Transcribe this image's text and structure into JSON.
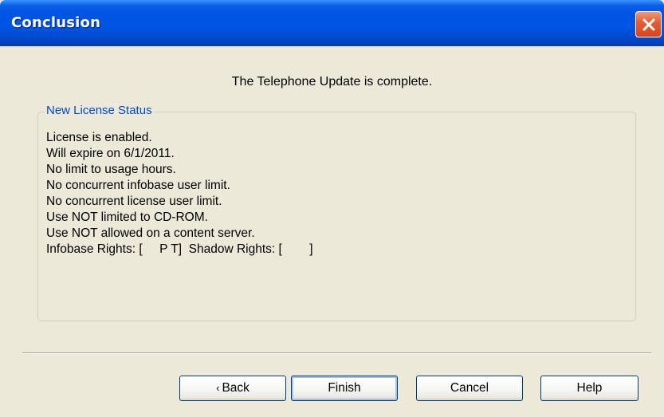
{
  "window": {
    "title": "Conclusion"
  },
  "main": {
    "headline": "The Telephone Update is complete."
  },
  "license_status": {
    "legend": "New License Status",
    "lines": [
      "License is enabled.",
      "Will expire on 6/1/2011.",
      "No limit to usage hours.",
      "No concurrent infobase user limit.",
      "No concurrent license user limit.",
      "Use NOT limited to CD-ROM.",
      "Use NOT allowed on a content server.",
      "Infobase Rights: [     P T]  Shadow Rights: [        ]"
    ]
  },
  "buttons": {
    "back_glyph": "‹",
    "back_label": "Back",
    "finish_label": "Finish",
    "cancel_label": "Cancel",
    "help_label": "Help"
  },
  "icons": {
    "close": "close-icon",
    "back_chevron": "chevron-left-icon"
  },
  "colors": {
    "titlebar": "#0054E3",
    "close_button": "#E35F36",
    "dialog_background": "#ECE9D8",
    "legend_text": "#0046D5"
  }
}
